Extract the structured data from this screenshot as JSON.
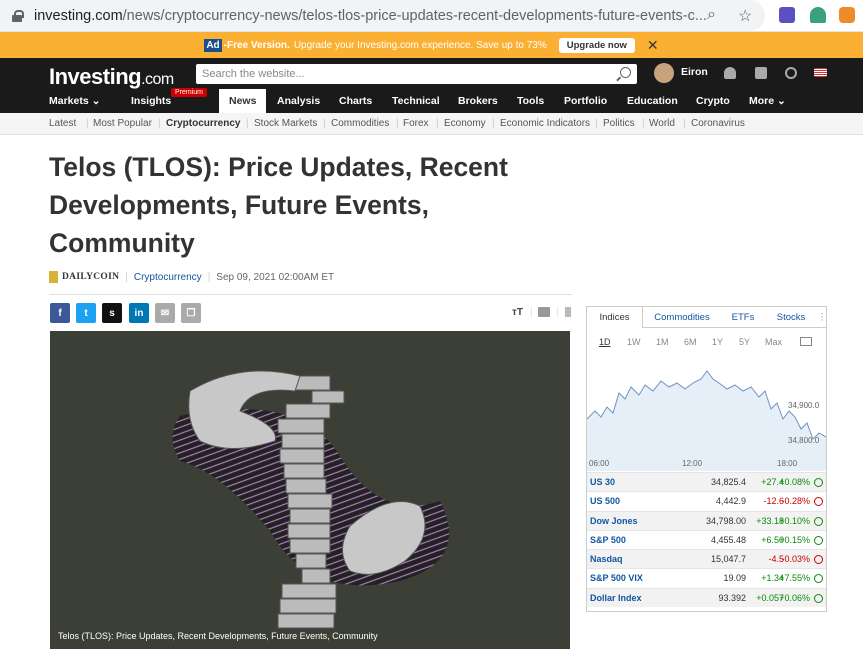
{
  "browser": {
    "url_host": "investing.com",
    "url_path": "/news/cryptocurrency-news/telos-tlos-price-updates-recent-developments-future-events-c..."
  },
  "ad_banner": {
    "badge": "Ad",
    "free_label": "-Free Version.",
    "text": "Upgrade your Investing.com experience. Save up to 73%",
    "button": "Upgrade now",
    "close": "✕"
  },
  "header": {
    "logo_main": "Investing",
    "logo_suffix": ".com",
    "search_placeholder": "Search the website...",
    "user_name": "Eiron"
  },
  "nav": {
    "items": [
      {
        "label": "Markets ⌄"
      },
      {
        "label": "Insights"
      },
      {
        "label": "News"
      },
      {
        "label": "Analysis"
      },
      {
        "label": "Charts"
      },
      {
        "label": "Technical"
      },
      {
        "label": "Brokers"
      },
      {
        "label": "Tools"
      },
      {
        "label": "Portfolio"
      },
      {
        "label": "Education"
      },
      {
        "label": "Crypto"
      },
      {
        "label": "More ⌄"
      }
    ],
    "premium_badge": "Premium"
  },
  "subnav": {
    "items": [
      "Latest",
      "Most Popular",
      "Cryptocurrency",
      "Stock Markets",
      "Commodities",
      "Forex",
      "Economy",
      "Economic Indicators",
      "Politics",
      "World",
      "Coronavirus"
    ]
  },
  "article": {
    "title": "Telos (TLOS): Price Updates, Recent Developments, Future Events, Community",
    "source": "DAILYCOIN",
    "category": "Cryptocurrency",
    "date": "Sep 09, 2021 02:00AM ET",
    "font_tool": "ᴛT",
    "caption": "Telos (TLOS): Price Updates, Recent Developments, Future Events, Community"
  },
  "share": {
    "facebook": "f",
    "twitter": "t",
    "stocktwits": "s",
    "linkedin": "in",
    "email": "✉",
    "copy": "❐"
  },
  "widget": {
    "tabs": [
      "Indices",
      "Commodities",
      "ETFs",
      "Stocks"
    ],
    "ranges": [
      "1D",
      "1W",
      "1M",
      "6M",
      "1Y",
      "5Y",
      "Max"
    ],
    "chart": {
      "y_labels": [
        "34,900.0",
        "34,800.0"
      ],
      "x_labels": [
        "06:00",
        "12:00",
        "18:00"
      ]
    },
    "rows": [
      {
        "name": "US 30",
        "last": "34,825.4",
        "chg": "+27.4",
        "pct": "+0.08%",
        "dir": "up"
      },
      {
        "name": "US 500",
        "last": "4,442.9",
        "chg": "-12.6",
        "pct": "-0.28%",
        "dir": "down"
      },
      {
        "name": "Dow Jones",
        "last": "34,798.00",
        "chg": "+33.18",
        "pct": "+0.10%",
        "dir": "up"
      },
      {
        "name": "S&P 500",
        "last": "4,455.48",
        "chg": "+6.50",
        "pct": "+0.15%",
        "dir": "up"
      },
      {
        "name": "Nasdaq",
        "last": "15,047.7",
        "chg": "-4.5",
        "pct": "-0.03%",
        "dir": "down"
      },
      {
        "name": "S&P 500 VIX",
        "last": "19.09",
        "chg": "+1.34",
        "pct": "+7.55%",
        "dir": "up"
      },
      {
        "name": "Dollar Index",
        "last": "93.392",
        "chg": "+0.057",
        "pct": "+0.06%",
        "dir": "up"
      }
    ]
  }
}
